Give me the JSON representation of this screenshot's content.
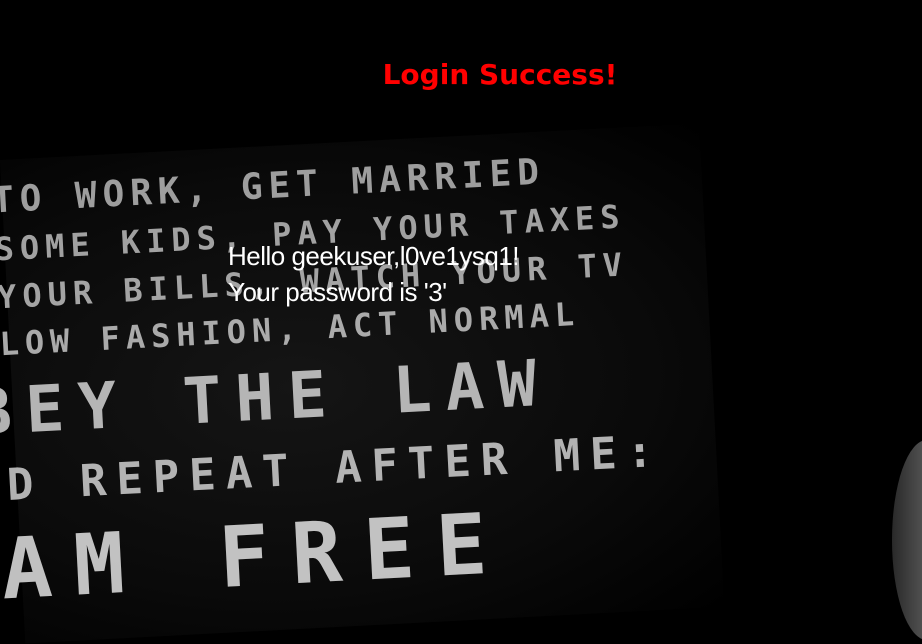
{
  "page": {
    "title": "Login Success!",
    "greeting": "Hello geekuser,l0ve1ysq1!",
    "password_message": "Your password is '3'"
  },
  "background": {
    "poster_lines": [
      "TO WORK, GET MARRIED",
      "SOME KIDS, PAY YOUR TAXES",
      "YOUR BILLS, WATCH YOUR TV",
      "LOW FASHION, ACT NORMAL",
      "BEY THE LAW",
      "D REPEAT AFTER ME:",
      "AM FREE"
    ]
  },
  "colors": {
    "background": "#000000",
    "title": "#ff0000",
    "text": "#ffffff"
  }
}
